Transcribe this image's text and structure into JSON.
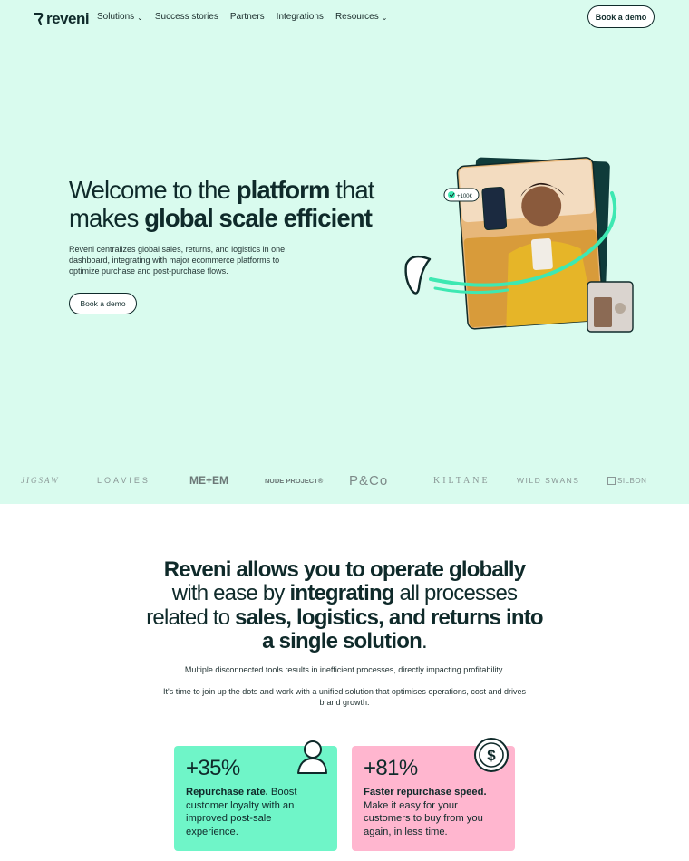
{
  "nav": {
    "logo": "reveni",
    "links": [
      {
        "label": "Solutions",
        "dropdown": true
      },
      {
        "label": "Success stories",
        "dropdown": false
      },
      {
        "label": "Partners",
        "dropdown": false
      },
      {
        "label": "Integrations",
        "dropdown": false
      },
      {
        "label": "Resources",
        "dropdown": true
      }
    ],
    "cta": "Book a demo"
  },
  "hero": {
    "title_part1": "Welcome to the ",
    "title_bold1": "platform",
    "title_part2": " that makes ",
    "title_bold2": "global scale efficient",
    "description": "Reveni centralizes global sales, returns, and logistics in one dashboard, integrating with major ecommerce platforms to optimize purchase and post-purchase flows.",
    "cta": "Book a demo",
    "badge": "+100€"
  },
  "brands": [
    "JIGSAW",
    "LOAVIES",
    "ME+EM",
    "NUDE PROJECT®",
    "P&Co",
    "KILTANE",
    "WILD SWANS",
    "SILBON"
  ],
  "section2": {
    "title_bold1": "Reveni allows you to operate globally",
    "title_part1": " with ease by ",
    "title_bold2": "integrating",
    "title_part2": " all processes related to ",
    "title_bold3": "sales, logistics, and returns",
    "title_part3": " ",
    "title_bold4": "into a single solution",
    "title_part4": ".",
    "paragraph1": "Multiple disconnected tools results in inefficient processes, directly impacting profitability.",
    "paragraph2": "It's time to join up the dots and work with a unified solution that optimises operations, cost and drives brand growth."
  },
  "stats": [
    {
      "value": "+35%",
      "title": "Repurchase rate.",
      "text": " Boost customer loyalty with an improved post-sale experience.",
      "icon": "person-icon",
      "color": "#6ff5c8"
    },
    {
      "value": "+81%",
      "title": "Faster repurchase speed.",
      "text": " Make it easy for your customers to buy from you again, in less time.",
      "icon": "dollar-icon",
      "color": "#ffb6cf"
    }
  ],
  "colors": {
    "hero_bg": "#d9fbee",
    "accent": "#3ee8b2",
    "dark": "#0f2a2a"
  }
}
